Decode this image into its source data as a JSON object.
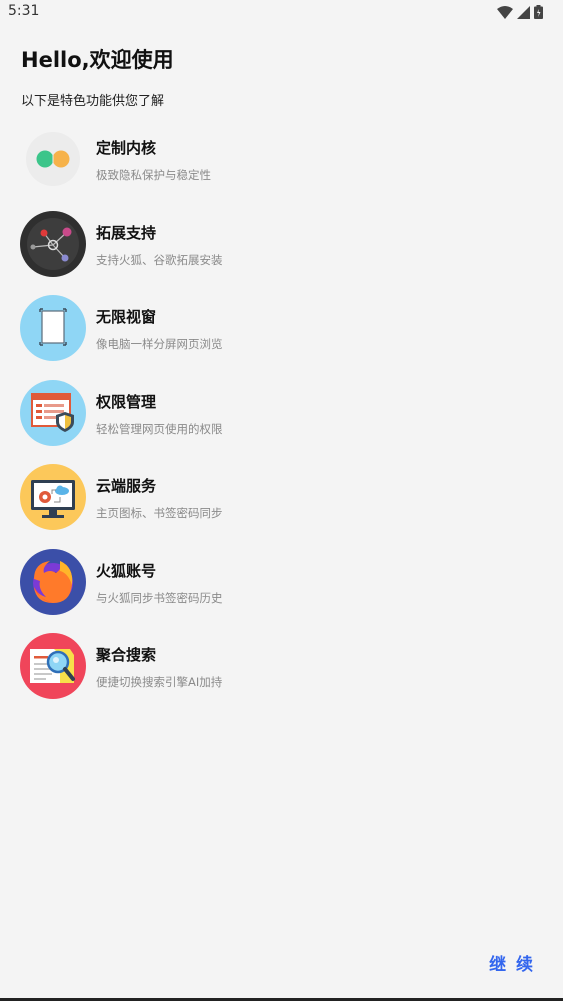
{
  "status_bar": {
    "time": "5:31",
    "icons": [
      "wifi-icon",
      "signal-icon",
      "battery-icon"
    ]
  },
  "header": {
    "title": "Hello,欢迎使用",
    "subtitle": "以下是特色功能供您了解"
  },
  "features": [
    {
      "name": "定制内核",
      "desc": "极致隐私保护与稳定性",
      "icon": "kernel-icon"
    },
    {
      "name": "拓展支持",
      "desc": "支持火狐、谷歌拓展安装",
      "icon": "extension-icon"
    },
    {
      "name": "无限视窗",
      "desc": "像电脑一样分屏网页浏览",
      "icon": "window-icon"
    },
    {
      "name": "权限管理",
      "desc": "轻松管理网页使用的权限",
      "icon": "permission-icon"
    },
    {
      "name": "云端服务",
      "desc": "主页图标、书签密码同步",
      "icon": "cloud-icon"
    },
    {
      "name": "火狐账号",
      "desc": "与火狐同步书签密码历史",
      "icon": "firefox-icon"
    },
    {
      "name": "聚合搜索",
      "desc": "便捷切换搜索引擎AI加持",
      "icon": "search-icon"
    }
  ],
  "footer": {
    "continue_label": "继 续"
  },
  "colors": {
    "accent": "#3366ee",
    "background": "#f4f4f4"
  }
}
